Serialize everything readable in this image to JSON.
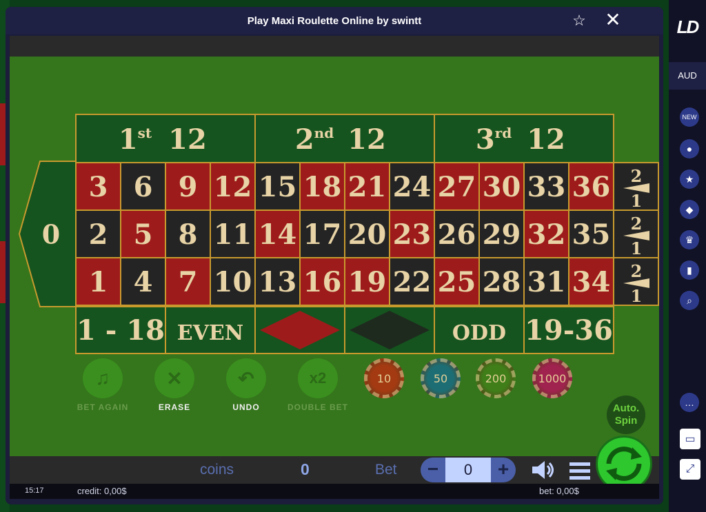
{
  "window": {
    "title": "Play Maxi Roulette Online by swintt"
  },
  "icons": {
    "favorite": "star-icon",
    "close": "close-icon"
  },
  "table": {
    "dozens": [
      {
        "num": "1",
        "sup": "st",
        "value": "12"
      },
      {
        "num": "2",
        "sup": "nd",
        "value": "12"
      },
      {
        "num": "3",
        "sup": "rd",
        "value": "12"
      }
    ],
    "zero": "0",
    "rows": [
      [
        "3",
        "6",
        "9",
        "12",
        "15",
        "18",
        "21",
        "24",
        "27",
        "30",
        "33",
        "36"
      ],
      [
        "2",
        "5",
        "8",
        "11",
        "14",
        "17",
        "20",
        "23",
        "26",
        "29",
        "32",
        "35"
      ],
      [
        "1",
        "4",
        "7",
        "10",
        "13",
        "16",
        "19",
        "22",
        "25",
        "28",
        "31",
        "34"
      ]
    ],
    "red_numbers": [
      "1",
      "3",
      "5",
      "7",
      "9",
      "12",
      "14",
      "16",
      "18",
      "19",
      "21",
      "23",
      "25",
      "27",
      "30",
      "32",
      "34",
      "36"
    ],
    "column_bets": [
      {
        "top": "2",
        "bottom": "1"
      },
      {
        "top": "2",
        "bottom": "1"
      },
      {
        "top": "2",
        "bottom": "1"
      }
    ],
    "outside_bets": [
      "1 - 18",
      "EVEN",
      "RED",
      "BLACK",
      "ODD",
      "19-36"
    ],
    "colors": {
      "felt": "#35751c",
      "green_cell": "#15541f",
      "red": "#9e1b1b",
      "black": "#242424",
      "gold": "#c89a2e",
      "text": "#e7d3a5"
    }
  },
  "controls": {
    "buttons": [
      {
        "label": "BET AGAIN",
        "icon": "bell-icon",
        "enabled": false
      },
      {
        "label": "ERASE",
        "icon": "x-icon",
        "enabled": true
      },
      {
        "label": "UNDO",
        "icon": "undo-icon",
        "enabled": true
      },
      {
        "label": "DOUBLE BET",
        "icon": "x2-icon",
        "enabled": false
      }
    ],
    "chips": [
      {
        "value": "10",
        "color": "#a33a12"
      },
      {
        "value": "50",
        "color": "#1c6e74"
      },
      {
        "value": "200",
        "color": "#3f7e19"
      },
      {
        "value": "1000",
        "color": "#a0224f"
      }
    ],
    "autospin": {
      "line1": "Auto.",
      "line2": "Spin"
    }
  },
  "bottom_bar": {
    "coins_label": "coins",
    "coins_value": "0",
    "bet_label": "Bet",
    "bet_value": "0",
    "minus": "−",
    "plus": "+"
  },
  "status_bar": {
    "time": "15:17",
    "credit": "credit: 0,00$",
    "bet": "bet: 0,00$"
  },
  "sidebar": {
    "logo": "LD",
    "currency": "AUD",
    "icons": [
      "new-icon",
      "drop-icon",
      "star-icon",
      "diamond-icon",
      "trophy-icon",
      "bookmark-icon",
      "search-icon",
      "chat-icon",
      "wallet-icon",
      "expand-icon"
    ]
  }
}
